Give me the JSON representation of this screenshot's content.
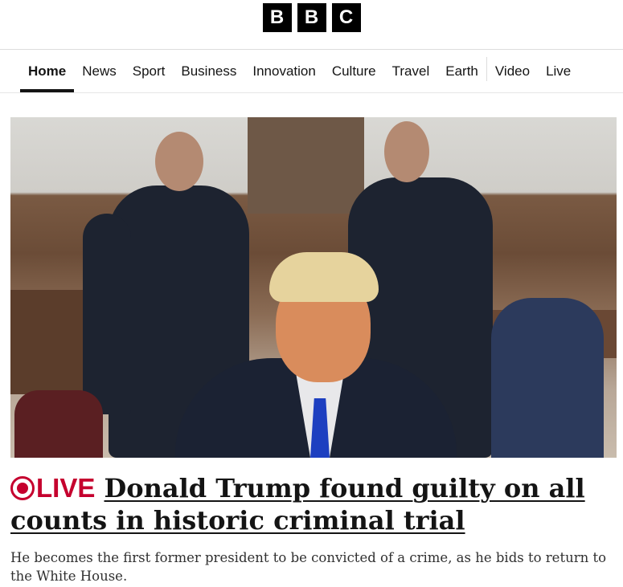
{
  "brand": {
    "letters": [
      "B",
      "B",
      "C"
    ]
  },
  "nav": {
    "items": [
      {
        "label": "Home",
        "active": true
      },
      {
        "label": "News"
      },
      {
        "label": "Sport"
      },
      {
        "label": "Business"
      },
      {
        "label": "Innovation"
      },
      {
        "label": "Culture"
      },
      {
        "label": "Travel"
      },
      {
        "label": "Earth"
      },
      {
        "label": "Video"
      },
      {
        "label": "Live"
      }
    ]
  },
  "lead_story": {
    "live_label": "LIVE",
    "headline": "Donald Trump found guilty on all counts in historic criminal trial",
    "summary": "He becomes the first former president to be convicted of a crime, as he bids to return to the White House."
  },
  "colors": {
    "live_red": "#c5002e",
    "text": "#141414"
  }
}
